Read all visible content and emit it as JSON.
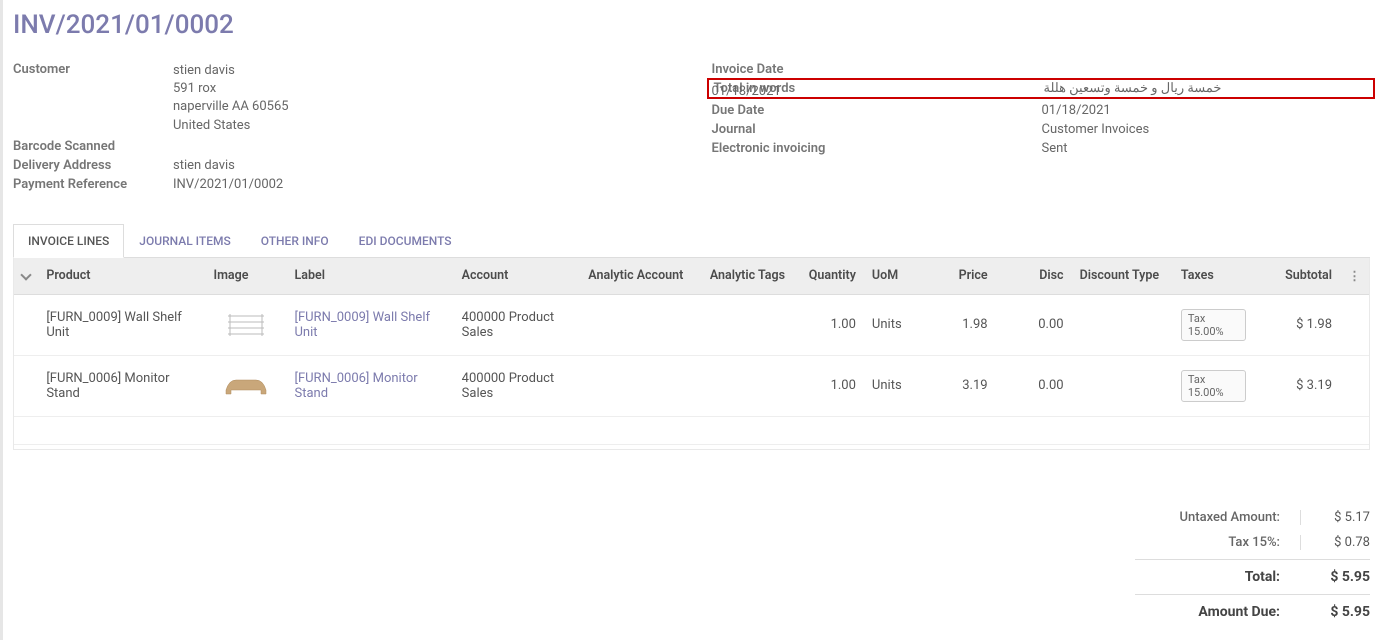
{
  "title": "INV/2021/01/0002",
  "left_fields": {
    "customer_label": "Customer",
    "customer_name": "stien davis",
    "customer_addr1": "591 rox",
    "customer_addr2": "naperville AA 60565",
    "customer_country": "United States",
    "barcode_label": "Barcode Scanned",
    "barcode_value": "",
    "delivery_label": "Delivery Address",
    "delivery_value": "stien davis",
    "payref_label": "Payment Reference",
    "payref_value": "INV/2021/01/0002"
  },
  "right_fields": {
    "invoice_date_label": "Invoice Date",
    "total_words_label": "Total in words",
    "total_words_value": "خمسة ريال و خمسة وتسعين هللة",
    "invoice_date_value": "01/18/2021",
    "due_date_label": "Due Date",
    "due_date_value": "01/18/2021",
    "journal_label": "Journal",
    "journal_value": "Customer Invoices",
    "einvoice_label": "Electronic invoicing",
    "einvoice_value": "Sent"
  },
  "tabs": {
    "invoice_lines": "INVOICE LINES",
    "journal_items": "JOURNAL ITEMS",
    "other_info": "OTHER INFO",
    "edi_documents": "EDI DOCUMENTS"
  },
  "columns": {
    "product": "Product",
    "image": "Image",
    "label": "Label",
    "account": "Account",
    "analytic_account": "Analytic Account",
    "analytic_tags": "Analytic Tags",
    "quantity": "Quantity",
    "uom": "UoM",
    "price": "Price",
    "disc": "Disc",
    "discount_type": "Discount Type",
    "taxes": "Taxes",
    "subtotal": "Subtotal"
  },
  "lines": [
    {
      "product": "[FURN_0009] Wall Shelf Unit",
      "label": "[FURN_0009] Wall Shelf Unit",
      "account": "400000 Product Sales",
      "analytic_account": "",
      "analytic_tags": "",
      "quantity": "1.00",
      "uom": "Units",
      "price": "1.98",
      "disc": "0.00",
      "discount_type": "",
      "tax": "Tax 15.00%",
      "subtotal": "$ 1.98"
    },
    {
      "product": "[FURN_0006] Monitor Stand",
      "label": "[FURN_0006] Monitor Stand",
      "account": "400000 Product Sales",
      "analytic_account": "",
      "analytic_tags": "",
      "quantity": "1.00",
      "uom": "Units",
      "price": "3.19",
      "disc": "0.00",
      "discount_type": "",
      "tax": "Tax 15.00%",
      "subtotal": "$ 3.19"
    }
  ],
  "totals": {
    "untaxed_label": "Untaxed Amount:",
    "untaxed_value": "$ 5.17",
    "tax_label": "Tax 15%:",
    "tax_value": "$ 0.78",
    "total_label": "Total:",
    "total_value": "$ 5.95",
    "due_label": "Amount Due:",
    "due_value": "$ 5.95"
  }
}
